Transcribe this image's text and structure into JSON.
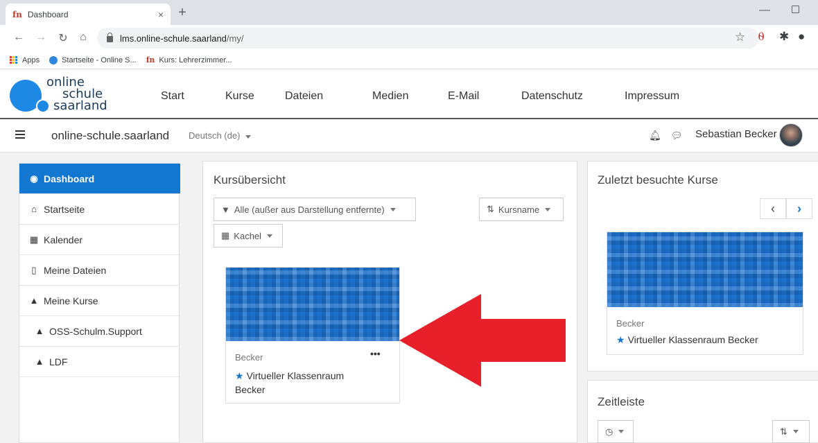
{
  "browser": {
    "tab_title": "Dashboard",
    "tab_favicon": "fn",
    "tab_close": "×",
    "new_tab": "+",
    "url_host": "lms.online-schule.saarland",
    "url_path": "/my/",
    "bookmarks": [
      {
        "label": "Apps"
      },
      {
        "label": "Startseite - Online S..."
      },
      {
        "label": "Kurs: Lehrerzimmer..."
      }
    ]
  },
  "site": {
    "logo_line1": "online",
    "logo_line2": "schule",
    "logo_line3": "saarland",
    "nav": [
      "Start",
      "Kurse",
      "Dateien",
      "Medien",
      "E-Mail",
      "Datenschutz",
      "Impressum"
    ],
    "name": "online-schule.saarland",
    "language": "Deutsch (de)",
    "user_name": "Sebastian Becker"
  },
  "sidebar": {
    "items": [
      {
        "label": "Dashboard",
        "icon": "dashboard-icon",
        "active": true
      },
      {
        "label": "Startseite",
        "icon": "home-icon"
      },
      {
        "label": "Kalender",
        "icon": "calendar-icon"
      },
      {
        "label": "Meine Dateien",
        "icon": "file-icon"
      },
      {
        "label": "Meine Kurse",
        "icon": "graduation-cap-icon"
      },
      {
        "label": "OSS-Schulm.Support",
        "icon": "graduation-cap-icon"
      },
      {
        "label": "LDF",
        "icon": "graduation-cap-icon"
      }
    ]
  },
  "course_overview": {
    "title": "Kursübersicht",
    "filter_label": "Alle (außer aus Darstellung entfernte)",
    "sort_label": "Kursname",
    "view_label": "Kachel",
    "course": {
      "category": "Becker",
      "name": "Virtueller Klassenraum Becker",
      "menu": "•••"
    }
  },
  "recent": {
    "title": "Zuletzt besuchte Kurse",
    "course": {
      "category": "Becker",
      "name": "Virtueller Klassenraum Becker"
    }
  },
  "timeline": {
    "title": "Zeitleiste"
  },
  "colors": {
    "accent": "#1177d1",
    "annotation_arrow": "#e8202a"
  }
}
